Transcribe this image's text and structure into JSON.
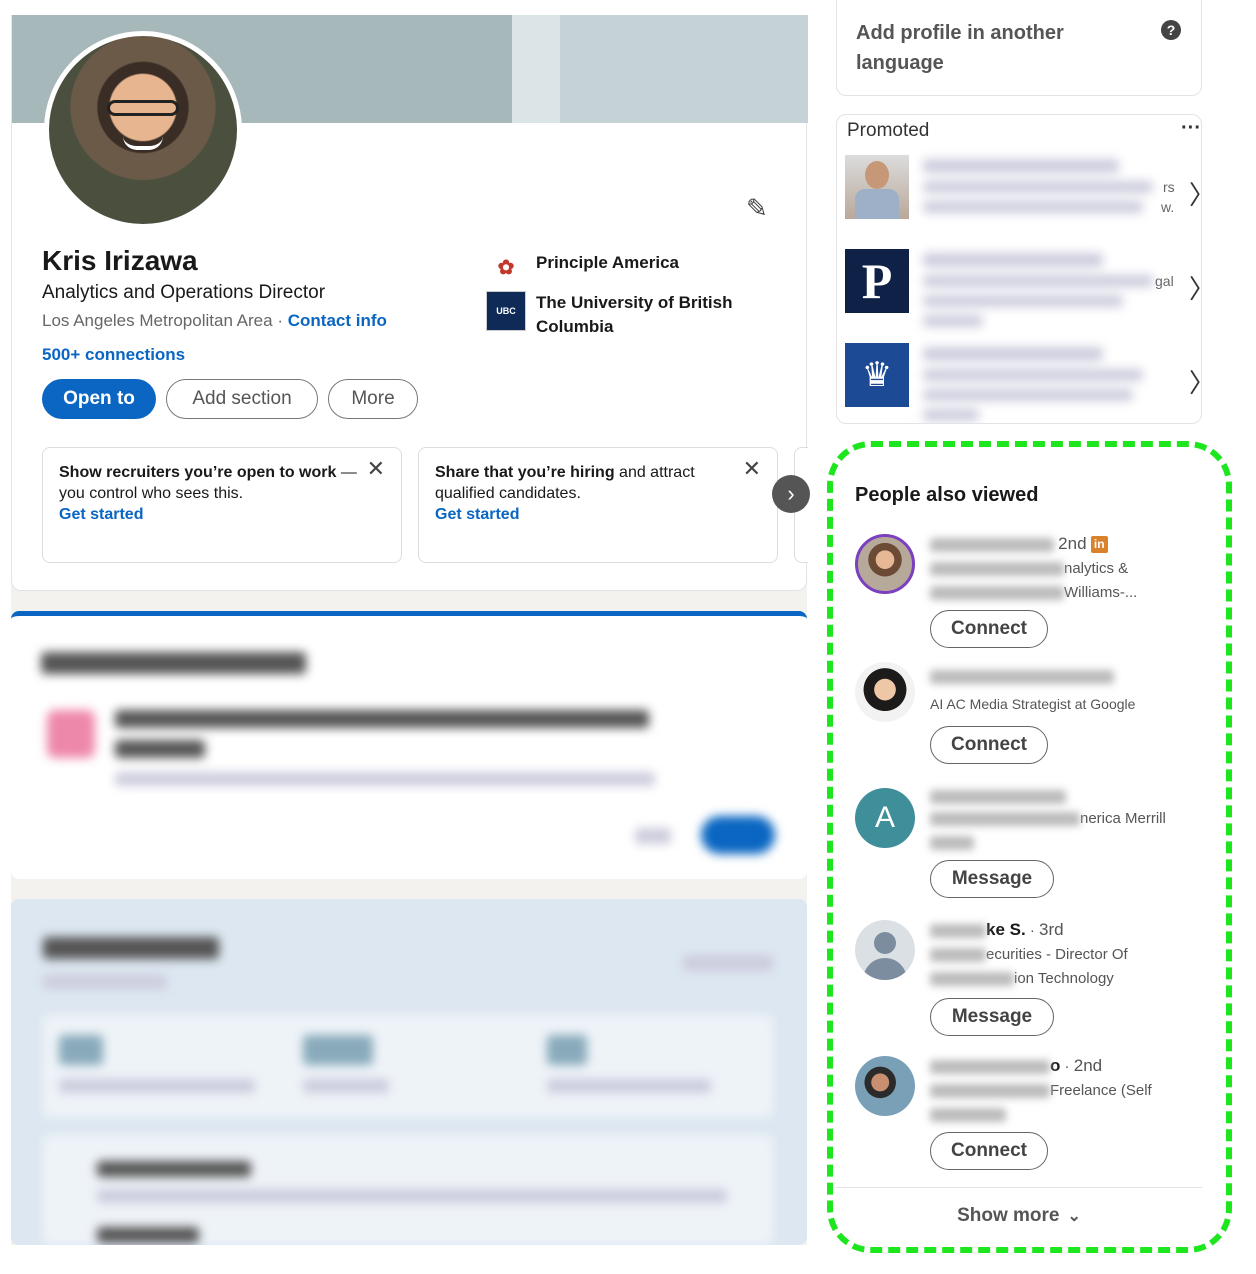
{
  "profile": {
    "name": "Kris Irizawa",
    "headline": "Analytics and Operations Director",
    "location": "Los Angeles Metropolitan Area",
    "separator": "·",
    "contact_info": "Contact info",
    "connections": "500+ connections",
    "buttons": {
      "open_to": "Open to",
      "add_section": "Add section",
      "more": "More"
    },
    "orgs": [
      {
        "name": "Principle America",
        "logo_text": "PRINCIPLE"
      },
      {
        "name": "The University of British Columbia",
        "logo_text": "UBC"
      }
    ]
  },
  "tips": [
    {
      "bold": "Show recruiters you’re open to work",
      "rest": " — you control who sees this.",
      "cta": "Get started"
    },
    {
      "bold": "Share that you’re hiring",
      "rest": " and attract qualified candidates.",
      "cta": "Get started"
    }
  ],
  "sidebar": {
    "language": {
      "text": "Add profile in another language",
      "help": "?"
    },
    "promoted": {
      "label": "Promoted",
      "more": "···",
      "frag1": "rs",
      "frag1b": "w.",
      "frag2": "gal",
      "logo_letter": "P"
    },
    "people_also_viewed": {
      "title": "People also viewed",
      "people": [
        {
          "degree": "2nd",
          "line2": "nalytics &",
          "line3": "Williams-...",
          "button": "Connect",
          "badge": "in"
        },
        {
          "line2": "AI AC Media Strategist at Google",
          "button": "Connect"
        },
        {
          "initial": "A",
          "line2": "nerica Merrill",
          "button": "Message"
        },
        {
          "name_frag": "ke S.",
          "degree": "3rd",
          "line2": "ecurities - Director Of",
          "line3": "ion Technology",
          "button": "Message"
        },
        {
          "name_frag": "o",
          "degree": "2nd",
          "line2": "Freelance (Self",
          "button": "Connect"
        }
      ],
      "show_more": "Show more"
    }
  },
  "colors": {
    "accent": "#0a66c2",
    "highlight": "#1ee61e"
  }
}
